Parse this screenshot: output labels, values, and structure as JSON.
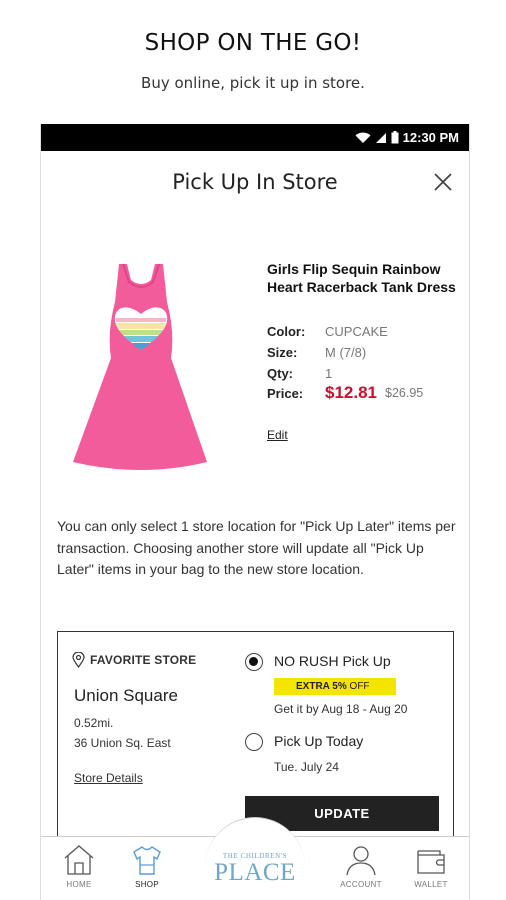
{
  "promo": {
    "title": "SHOP ON THE GO!",
    "subtitle": "Buy online, pick it up in store."
  },
  "status_bar": {
    "time": "12:30 PM",
    "icons": [
      "wifi-icon",
      "signal-icon",
      "battery-icon"
    ]
  },
  "modal": {
    "title": "Pick Up In Store",
    "close_icon": "close-icon"
  },
  "product": {
    "name": "Girls Flip Sequin Rainbow Heart Racerback Tank Dress",
    "color_label": "Color:",
    "color_value": "CUPCAKE",
    "size_label": "Size:",
    "size_value": "M (7/8)",
    "qty_label": "Qty:",
    "qty_value": "1",
    "price_label": "Price:",
    "price_now": "$12.81",
    "price_was": "$26.95",
    "edit_label": "Edit",
    "dress_color": "#f25c9a"
  },
  "notice": "You can only select 1 store location for \"Pick Up Later\" items per transaction. Choosing another store will update all \"Pick Up Later\" items in your bag to the new store location.",
  "store": {
    "favorite_label": "FAVORITE STORE",
    "name": "Union Square",
    "distance": "0.52mi.",
    "address": "36 Union Sq. East",
    "details_label": "Store Details"
  },
  "pickup_options": {
    "no_rush": {
      "label": "NO RUSH Pick Up",
      "badge_strong": "EXTRA 5%",
      "badge_rest": " OFF",
      "subtext": "Get it by Aug 18 - Aug 20",
      "selected": true
    },
    "today": {
      "label": "Pick Up Today",
      "subtext": "Tue. July 24",
      "selected": false
    }
  },
  "update_button": "UPDATE",
  "bottom_nav": {
    "home": "HOME",
    "shop": "SHOP",
    "logo_small": "THE CHILDREN'S",
    "logo_big": "PLACE",
    "account": "ACCOUNT",
    "wallet": "WALLET"
  },
  "colors": {
    "sale_price": "#c8102e",
    "badge_yellow": "#f5e400",
    "logo_blue": "#6fa6c9",
    "shop_active_blue": "#5b9bd5"
  }
}
